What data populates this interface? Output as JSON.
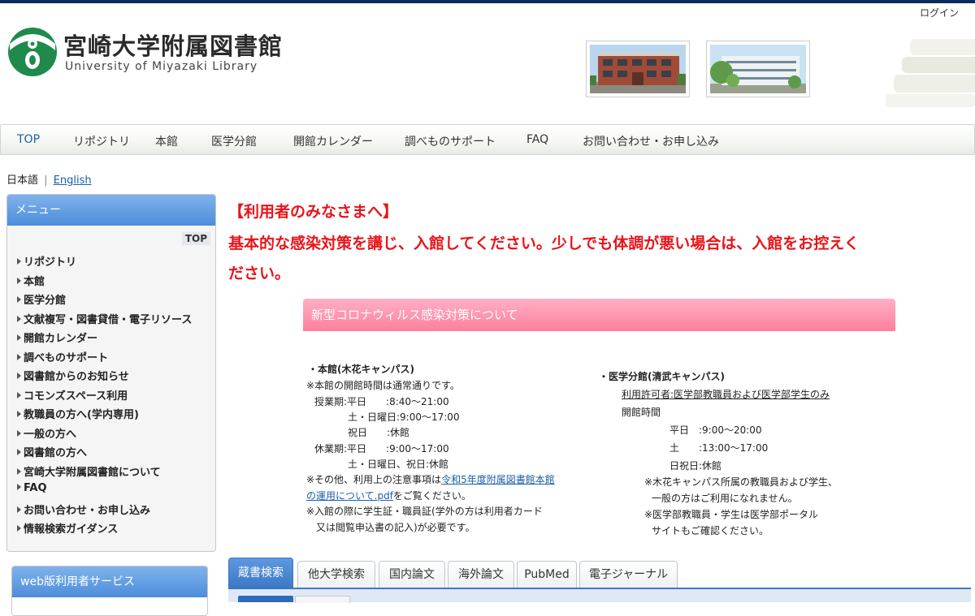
{
  "header": {
    "login": "ログイン",
    "logo_jp": "宮崎大学附属図書館",
    "logo_en": "University of Miyazaki Library"
  },
  "nav": [
    "TOP",
    "リポジトリ",
    "本館",
    "医学分館",
    "開館カレンダー",
    "調べものサポート",
    "FAQ",
    "お問い合わせ・お申し込み"
  ],
  "lang": {
    "current": "日本語",
    "sep": "|",
    "other": "English"
  },
  "menu": {
    "title": "メニュー",
    "top": "TOP",
    "items": [
      "リポジトリ",
      "本館",
      "医学分館",
      "文献複写・図書貸借・電子リソース",
      "開館カレンダー",
      "調べものサポート",
      "図書館からのお知らせ",
      "コモンズスペース利用",
      "教職員の方へ(学内専用)",
      "一般の方へ",
      "図書館の方へ",
      "宮崎大学附属図書館について",
      "FAQ",
      "お問い合わせ・お申し込み",
      "情報検索ガイダンス"
    ]
  },
  "web_service": {
    "title": "web版利用者サービス"
  },
  "notice": {
    "line1": "【利用者のみなさまへ】",
    "line2": "基本的な感染対策を講じ、入館してください。少しでも体調が悪い場合は、入館をお控えく",
    "line3": "ださい。"
  },
  "covid": {
    "title": "新型コロナウィルス感染対策について",
    "main": {
      "heading": "・本館(木花キャンパス)",
      "l1": "※本館の開館時間は通常通りです。",
      "l2": "授業期:平日　　:8:40〜21:00",
      "l3": "土・日曜日:9:00〜17:00",
      "l4": "祝日　　:休館",
      "l5": "休業期:平日　　:9:00〜17:00",
      "l6": "土・日曜日、祝日:休館",
      "l7_pre": "※その他、利用上の注意事項は",
      "l7_link": "令和5年度附属図書館本館",
      "l8_link": "の運用について.pdf",
      "l8_post": "をご覧ください。",
      "l9": "※入館の際に学生証・職員証(学外の方は利用者カード",
      "l10": "又は閲覧申込書の記入)が必要です。"
    },
    "med": {
      "heading": "・医学分館(清武キャンパス)",
      "l1": "利用許可者:医学部教職員および医学部学生のみ",
      "l2": "開館時間",
      "l3": "平日　:9:00〜20:00",
      "l4": "土　　:13:00〜17:00",
      "l5": "日祝日:休館",
      "l6": "※木花キャンパス所属の教職員および学生、",
      "l7": "一般の方はご利用になれません。",
      "l8": "※医学部教職員・学生は医学部ポータル",
      "l9": "サイトもご確認ください。"
    }
  },
  "search_tabs": [
    "蔵書検索",
    "他大学検索",
    "国内論文",
    "海外論文",
    "PubMed",
    "電子ジャーナル"
  ],
  "colors": {
    "accent_blue": "#4d8ddb",
    "notice_red": "#e8141a",
    "covid_pink": "#ff7f9e",
    "top_bar": "#0c2a5c"
  }
}
